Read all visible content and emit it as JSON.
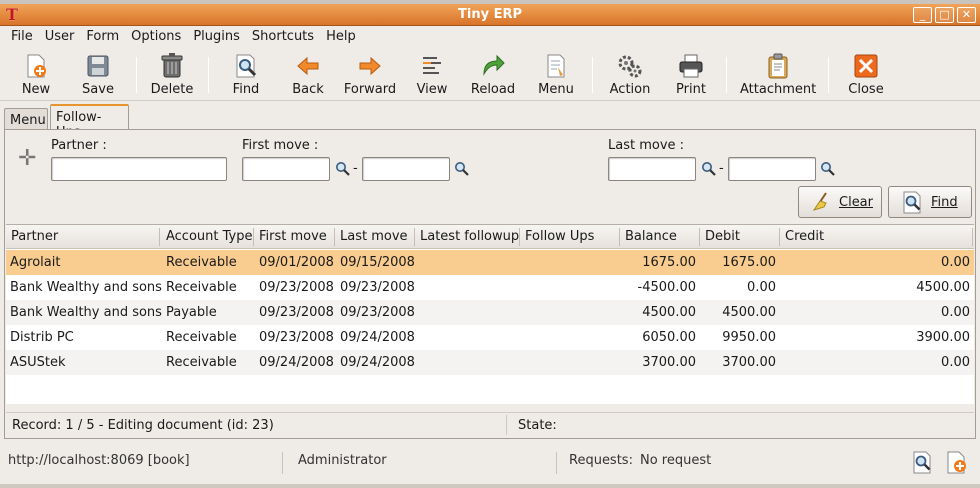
{
  "window": {
    "title": "Tiny ERP",
    "app_icon": "tinyerp-logo-icon"
  },
  "menubar": [
    "File",
    "User",
    "Form",
    "Options",
    "Plugins",
    "Shortcuts",
    "Help"
  ],
  "toolbar": {
    "new": "New",
    "save": "Save",
    "delete": "Delete",
    "find": "Find",
    "back": "Back",
    "forward": "Forward",
    "view": "View",
    "reload": "Reload",
    "menu": "Menu",
    "action": "Action",
    "print": "Print",
    "attachment": "Attachment",
    "close": "Close"
  },
  "tabs": [
    "Menu",
    "Follow-Ups"
  ],
  "search": {
    "partner_label": "Partner :",
    "first_move_label": "First move :",
    "last_move_label": "Last move :",
    "partner_value": "",
    "first_from": "",
    "first_to": "",
    "last_from": "",
    "last_to": "",
    "dash": "-",
    "clear_label": "Clear",
    "find_label": "Find"
  },
  "table": {
    "columns": [
      "Partner",
      "Account Type",
      "First move",
      "Last move",
      "Latest followup",
      "Follow Ups",
      "Balance",
      "Debit",
      "Credit"
    ],
    "rows": [
      {
        "partner": "Agrolait",
        "type": "Receivable",
        "first": "09/01/2008",
        "last": "09/15/2008",
        "latest": "",
        "followups": "",
        "balance": "1675.00",
        "debit": "1675.00",
        "credit": "0.00"
      },
      {
        "partner": "Bank Wealthy and sons",
        "type": "Receivable",
        "first": "09/23/2008",
        "last": "09/23/2008",
        "latest": "",
        "followups": "",
        "balance": "-4500.00",
        "debit": "0.00",
        "credit": "4500.00"
      },
      {
        "partner": "Bank Wealthy and sons",
        "type": "Payable",
        "first": "09/23/2008",
        "last": "09/23/2008",
        "latest": "",
        "followups": "",
        "balance": "4500.00",
        "debit": "4500.00",
        "credit": "0.00"
      },
      {
        "partner": "Distrib PC",
        "type": "Receivable",
        "first": "09/23/2008",
        "last": "09/24/2008",
        "latest": "",
        "followups": "",
        "balance": "6050.00",
        "debit": "9950.00",
        "credit": "3900.00"
      },
      {
        "partner": "ASUStek",
        "type": "Receivable",
        "first": "09/24/2008",
        "last": "09/24/2008",
        "latest": "",
        "followups": "",
        "balance": "3700.00",
        "debit": "3700.00",
        "credit": "0.00"
      }
    ]
  },
  "record_status": {
    "record": "Record: 1 / 5 - Editing document (id: 23)",
    "state_label": "State:"
  },
  "statusbar": {
    "server": "http://localhost:8069 [book]",
    "user": "Administrator",
    "requests_label": "Requests:",
    "requests_value": "No request"
  }
}
